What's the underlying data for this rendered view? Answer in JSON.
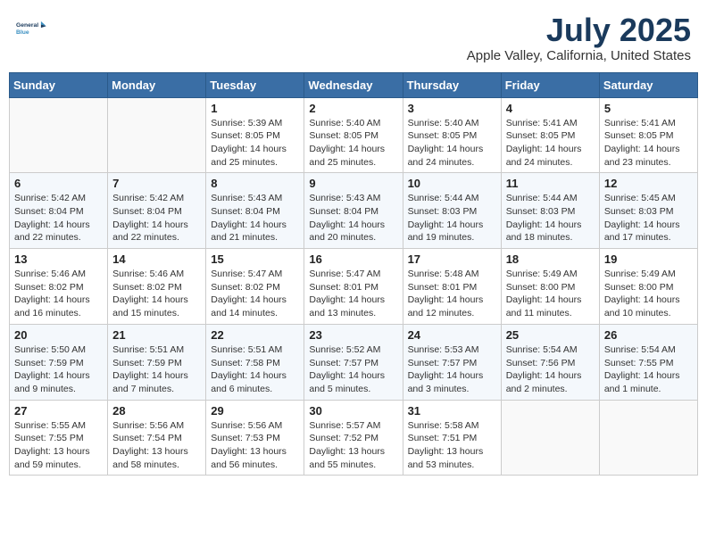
{
  "header": {
    "logo_line1": "General",
    "logo_line2": "Blue",
    "month_year": "July 2025",
    "location": "Apple Valley, California, United States"
  },
  "days_of_week": [
    "Sunday",
    "Monday",
    "Tuesday",
    "Wednesday",
    "Thursday",
    "Friday",
    "Saturday"
  ],
  "weeks": [
    [
      {
        "day": "",
        "info": ""
      },
      {
        "day": "",
        "info": ""
      },
      {
        "day": "1",
        "info": "Sunrise: 5:39 AM\nSunset: 8:05 PM\nDaylight: 14 hours and 25 minutes."
      },
      {
        "day": "2",
        "info": "Sunrise: 5:40 AM\nSunset: 8:05 PM\nDaylight: 14 hours and 25 minutes."
      },
      {
        "day": "3",
        "info": "Sunrise: 5:40 AM\nSunset: 8:05 PM\nDaylight: 14 hours and 24 minutes."
      },
      {
        "day": "4",
        "info": "Sunrise: 5:41 AM\nSunset: 8:05 PM\nDaylight: 14 hours and 24 minutes."
      },
      {
        "day": "5",
        "info": "Sunrise: 5:41 AM\nSunset: 8:05 PM\nDaylight: 14 hours and 23 minutes."
      }
    ],
    [
      {
        "day": "6",
        "info": "Sunrise: 5:42 AM\nSunset: 8:04 PM\nDaylight: 14 hours and 22 minutes."
      },
      {
        "day": "7",
        "info": "Sunrise: 5:42 AM\nSunset: 8:04 PM\nDaylight: 14 hours and 22 minutes."
      },
      {
        "day": "8",
        "info": "Sunrise: 5:43 AM\nSunset: 8:04 PM\nDaylight: 14 hours and 21 minutes."
      },
      {
        "day": "9",
        "info": "Sunrise: 5:43 AM\nSunset: 8:04 PM\nDaylight: 14 hours and 20 minutes."
      },
      {
        "day": "10",
        "info": "Sunrise: 5:44 AM\nSunset: 8:03 PM\nDaylight: 14 hours and 19 minutes."
      },
      {
        "day": "11",
        "info": "Sunrise: 5:44 AM\nSunset: 8:03 PM\nDaylight: 14 hours and 18 minutes."
      },
      {
        "day": "12",
        "info": "Sunrise: 5:45 AM\nSunset: 8:03 PM\nDaylight: 14 hours and 17 minutes."
      }
    ],
    [
      {
        "day": "13",
        "info": "Sunrise: 5:46 AM\nSunset: 8:02 PM\nDaylight: 14 hours and 16 minutes."
      },
      {
        "day": "14",
        "info": "Sunrise: 5:46 AM\nSunset: 8:02 PM\nDaylight: 14 hours and 15 minutes."
      },
      {
        "day": "15",
        "info": "Sunrise: 5:47 AM\nSunset: 8:02 PM\nDaylight: 14 hours and 14 minutes."
      },
      {
        "day": "16",
        "info": "Sunrise: 5:47 AM\nSunset: 8:01 PM\nDaylight: 14 hours and 13 minutes."
      },
      {
        "day": "17",
        "info": "Sunrise: 5:48 AM\nSunset: 8:01 PM\nDaylight: 14 hours and 12 minutes."
      },
      {
        "day": "18",
        "info": "Sunrise: 5:49 AM\nSunset: 8:00 PM\nDaylight: 14 hours and 11 minutes."
      },
      {
        "day": "19",
        "info": "Sunrise: 5:49 AM\nSunset: 8:00 PM\nDaylight: 14 hours and 10 minutes."
      }
    ],
    [
      {
        "day": "20",
        "info": "Sunrise: 5:50 AM\nSunset: 7:59 PM\nDaylight: 14 hours and 9 minutes."
      },
      {
        "day": "21",
        "info": "Sunrise: 5:51 AM\nSunset: 7:59 PM\nDaylight: 14 hours and 7 minutes."
      },
      {
        "day": "22",
        "info": "Sunrise: 5:51 AM\nSunset: 7:58 PM\nDaylight: 14 hours and 6 minutes."
      },
      {
        "day": "23",
        "info": "Sunrise: 5:52 AM\nSunset: 7:57 PM\nDaylight: 14 hours and 5 minutes."
      },
      {
        "day": "24",
        "info": "Sunrise: 5:53 AM\nSunset: 7:57 PM\nDaylight: 14 hours and 3 minutes."
      },
      {
        "day": "25",
        "info": "Sunrise: 5:54 AM\nSunset: 7:56 PM\nDaylight: 14 hours and 2 minutes."
      },
      {
        "day": "26",
        "info": "Sunrise: 5:54 AM\nSunset: 7:55 PM\nDaylight: 14 hours and 1 minute."
      }
    ],
    [
      {
        "day": "27",
        "info": "Sunrise: 5:55 AM\nSunset: 7:55 PM\nDaylight: 13 hours and 59 minutes."
      },
      {
        "day": "28",
        "info": "Sunrise: 5:56 AM\nSunset: 7:54 PM\nDaylight: 13 hours and 58 minutes."
      },
      {
        "day": "29",
        "info": "Sunrise: 5:56 AM\nSunset: 7:53 PM\nDaylight: 13 hours and 56 minutes."
      },
      {
        "day": "30",
        "info": "Sunrise: 5:57 AM\nSunset: 7:52 PM\nDaylight: 13 hours and 55 minutes."
      },
      {
        "day": "31",
        "info": "Sunrise: 5:58 AM\nSunset: 7:51 PM\nDaylight: 13 hours and 53 minutes."
      },
      {
        "day": "",
        "info": ""
      },
      {
        "day": "",
        "info": ""
      }
    ]
  ]
}
